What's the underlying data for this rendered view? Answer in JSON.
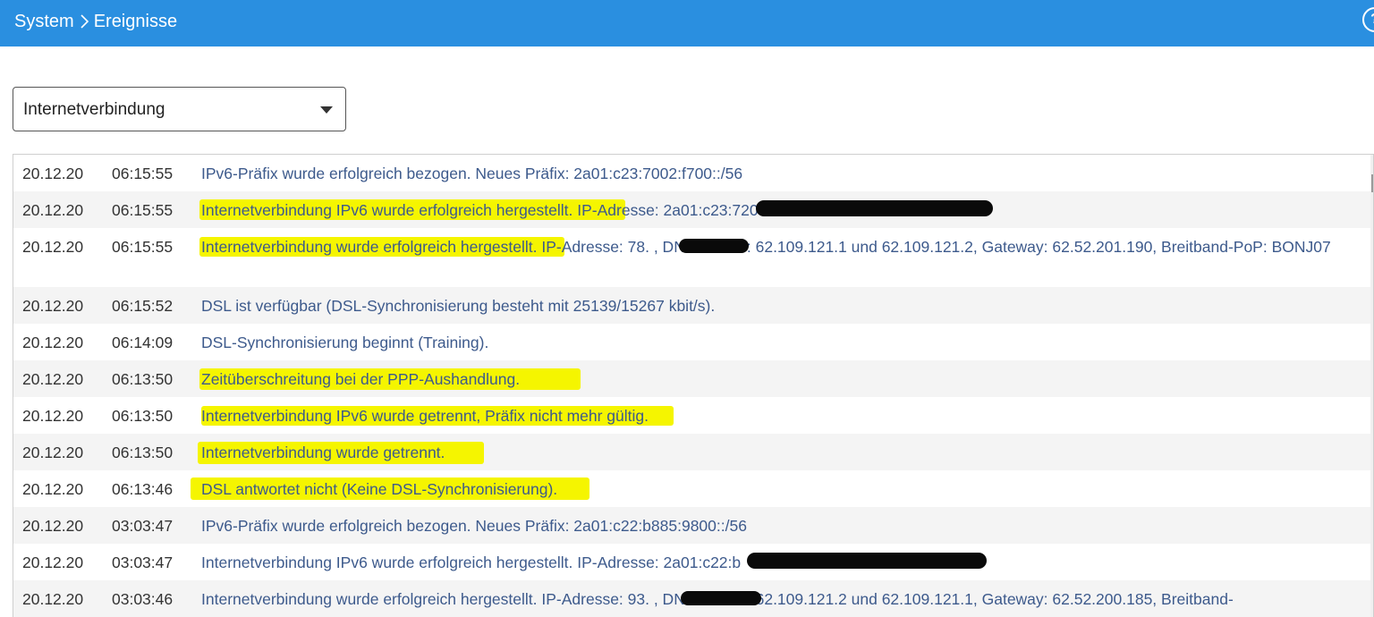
{
  "header": {
    "breadcrumb": [
      {
        "label": "System"
      },
      {
        "label": "Ereignisse"
      }
    ],
    "help_label": "?"
  },
  "filter": {
    "selected": "Internetverbindung"
  },
  "events": [
    {
      "date": "20.12.20",
      "time": "06:15:55",
      "message": "IPv6-Präfix wurde erfolgreich bezogen. Neues Präfix: 2a01:c23:7002:f700::/56"
    },
    {
      "date": "20.12.20",
      "time": "06:15:55",
      "message": "Internetverbindung IPv6 wurde erfolgreich hergestellt. IP-Adresse: 2a01:c23:7200:20"
    },
    {
      "date": "20.12.20",
      "time": "06:15:55",
      "message": "Internetverbindung wurde erfolgreich hergestellt. IP-Adresse: 78.            , DNS-Server: 62.109.121.1 und 62.109.121.2, Gateway: 62.52.201.190, Breitband-PoP: BONJ07"
    },
    {
      "date": "20.12.20",
      "time": "06:15:52",
      "message": "DSL ist verfügbar (DSL-Synchronisierung besteht mit 25139/15267 kbit/s)."
    },
    {
      "date": "20.12.20",
      "time": "06:14:09",
      "message": "DSL-Synchronisierung beginnt (Training)."
    },
    {
      "date": "20.12.20",
      "time": "06:13:50",
      "message": "Zeitüberschreitung bei der PPP-Aushandlung."
    },
    {
      "date": "20.12.20",
      "time": "06:13:50",
      "message": "Internetverbindung IPv6 wurde getrennt, Präfix nicht mehr gültig."
    },
    {
      "date": "20.12.20",
      "time": "06:13:50",
      "message": "Internetverbindung wurde getrennt."
    },
    {
      "date": "20.12.20",
      "time": "06:13:46",
      "message": "DSL antwortet nicht (Keine DSL-Synchronisierung)."
    },
    {
      "date": "20.12.20",
      "time": "03:03:47",
      "message": "IPv6-Präfix wurde erfolgreich bezogen. Neues Präfix: 2a01:c22:b885:9800::/56"
    },
    {
      "date": "20.12.20",
      "time": "03:03:47",
      "message": "Internetverbindung IPv6 wurde erfolgreich hergestellt. IP-Adresse: 2a01:c22:b"
    },
    {
      "date": "20.12.20",
      "time": "03:03:46",
      "message": "Internetverbindung wurde erfolgreich hergestellt. IP-Adresse: 93.           , DNS-Server: 62.109.121.2 und 62.109.121.1, Gateway: 62.52.200.185, Breitband-"
    }
  ],
  "colors": {
    "header_bg": "#2a8fe0",
    "message_text": "#3d5a8c",
    "highlight": "#f5f500"
  }
}
